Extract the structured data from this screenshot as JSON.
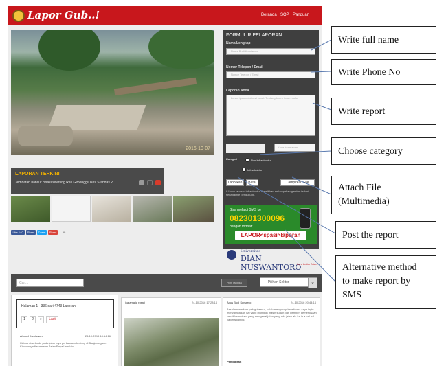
{
  "app": {
    "brand": "Lapor Gub..!",
    "nav": [
      "Beranda",
      "SOP",
      "Panduan"
    ]
  },
  "hero": {
    "date_stamp": "2016-10-07"
  },
  "news": {
    "title": "LAPORAN TERKINI",
    "text": "Jembatan hancur disasi sisetung ikas Gimenggu ikes Srandas 2"
  },
  "share": [
    "Like 140",
    "Share",
    "Tweet",
    "Share",
    "50"
  ],
  "form": {
    "title": "FORMULIR PELAPORAN",
    "name_label": "Nama Lengkap",
    "name_placeholder": "Nama Budi Kurniawan",
    "phone_label": "Nomor Telepon / Email",
    "phone_placeholder": "Nomor Telepon / Email",
    "report_label": "Laporan Anda",
    "report_placeholder": "Lorem ipsum dolor sit amet. Tentang lorem ipsum dolor.",
    "captcha_placeholder": "Kode keamanan",
    "category_label": "Kategori",
    "category_options": [
      "Non Infrastruktur",
      "Infrastruktur"
    ],
    "buttons": {
      "report": "Laporkan",
      "reset": "Batal",
      "attach": "Lampirkan File"
    },
    "note": "* Untuk laporan infrastruktur diwajibkan melampirkan gambar terkini sebagai file pendukung."
  },
  "sms": {
    "top": "Bisa melalui SMS ke",
    "number": "082301300096",
    "mid": "dengan format:",
    "format": "LAPOR<spasi>laporan"
  },
  "sponsor": {
    "supported": "Supported by",
    "university": "Universitas",
    "name": "DIAN NUSWANTORO",
    "tagline": "for a better future"
  },
  "filter": {
    "search_placeholder": "Cari...",
    "date_placeholder": "Pilih Tanggal",
    "sector": "-- Pilihan Sektor --",
    "sector_icon": "chevron-down-icon"
  },
  "pager": {
    "text": "Halaman 1 - 336 dari 4743 Laporan",
    "pages": [
      "1",
      "2",
      "»",
      "Last"
    ]
  },
  "cards": [
    {
      "name": "Ahmad Kurniawan",
      "time": "24-10-2016 18:14:16",
      "text": "Kiriman barrikade pada jalan raya perbatasan kedung di Banjarnegara. Khususnya Kecamatan Jalan Raya Lain-lain"
    },
    {
      "name": "ika amalia rosati",
      "time": "24-10-2016 17:28:14",
      "text": ""
    },
    {
      "name": "Agus Budi Sumaryo",
      "time": "24-10-2016 20:44:14",
      "text": "Assalamualaikum pak gubernur, salah mengucap kata forma saya ingin menyampaikan hal yang mungkin masih sudah dari pemberi pemeriksaan sekali kemudian, yang mengenai jalan yang ada jalan ala ka ia a hal hal ya kejadian ini."
    },
    {
      "footer": "Pendidikan"
    }
  ],
  "annotations": [
    "Write  full name",
    "Write Phone No",
    "Write report",
    "Choose category",
    "Attach File\n(Multimedia)",
    "Post the report",
    "Alternative method\nto make report by\nSMS"
  ]
}
